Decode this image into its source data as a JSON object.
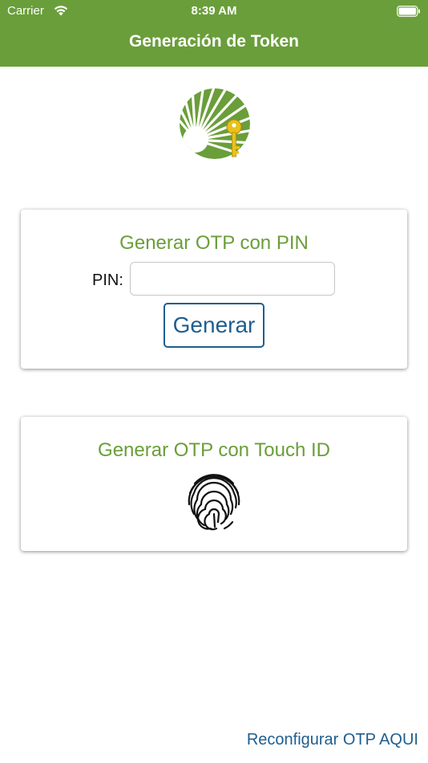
{
  "status_bar": {
    "carrier": "Carrier",
    "time": "8:39 AM"
  },
  "nav": {
    "title": "Generación de Token"
  },
  "logo": {
    "icon": "sun-key-logo-icon"
  },
  "pin_card": {
    "title": "Generar OTP con PIN",
    "pin_label": "PIN:",
    "pin_value": "",
    "pin_placeholder": "",
    "button_label": "Generar"
  },
  "touch_card": {
    "title": "Generar OTP con Touch ID",
    "icon": "fingerprint-icon"
  },
  "footer": {
    "reconfig_link": "Reconfigurar OTP AQUI"
  },
  "colors": {
    "brand_green": "#6a9e3a",
    "link_blue": "#1f5e8e",
    "key_yellow": "#e8c11a"
  }
}
